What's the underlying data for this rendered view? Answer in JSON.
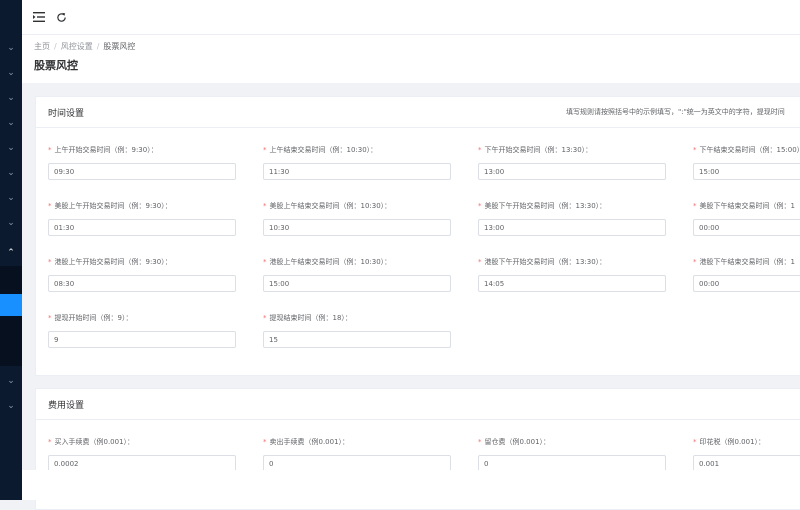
{
  "topbar": {
    "menu_icon": "indent-icon",
    "refresh_icon": "refresh-icon"
  },
  "breadcrumb": {
    "items": [
      "主页",
      "风控设置",
      "股票风控"
    ]
  },
  "page_title": "股票风控",
  "time_card": {
    "title": "时间设置",
    "hint": "填写规则请按照括号中的示例填写，\":\"统一为英文中的字符，提现时间",
    "fields": [
      {
        "label": "上午开始交易时间（例：9:30）：",
        "value": "09:30"
      },
      {
        "label": "上午结束交易时间（例：10:30）：",
        "value": "11:30"
      },
      {
        "label": "下午开始交易时间（例：13:30）：",
        "value": "13:00"
      },
      {
        "label": "下午结束交易时间（例：15:00）",
        "value": "15:00"
      },
      {
        "label": "美股上午开始交易时间（例：9:30）：",
        "value": "01:30"
      },
      {
        "label": "美股上午结束交易时间（例：10:30）：",
        "value": "10:30"
      },
      {
        "label": "美股下午开始交易时间（例：13:30）：",
        "value": "13:00"
      },
      {
        "label": "美股下午结束交易时间（例：1",
        "value": "00:00"
      },
      {
        "label": "港股上午开始交易时间（例：9:30）：",
        "value": "08:30"
      },
      {
        "label": "港股上午结束交易时间（例：10:30）：",
        "value": "15:00"
      },
      {
        "label": "港股下午开始交易时间（例：13:30）：",
        "value": "14:05"
      },
      {
        "label": "港股下午结束交易时间（例：1",
        "value": "00:00"
      },
      {
        "label": "提现开始时间（例：9）：",
        "value": "9"
      },
      {
        "label": "提现结束时间（例：18）：",
        "value": "15"
      }
    ]
  },
  "fee_card": {
    "title": "费用设置",
    "fields": [
      {
        "label": "买入手续费（例0.001）：",
        "value": "0.0002"
      },
      {
        "label": "卖出手续费（例0.001）：",
        "value": "0"
      },
      {
        "label": "留仓费（例0.001）：",
        "value": "0"
      },
      {
        "label": "印花税（例0.001）：",
        "value": "0.001"
      }
    ]
  }
}
